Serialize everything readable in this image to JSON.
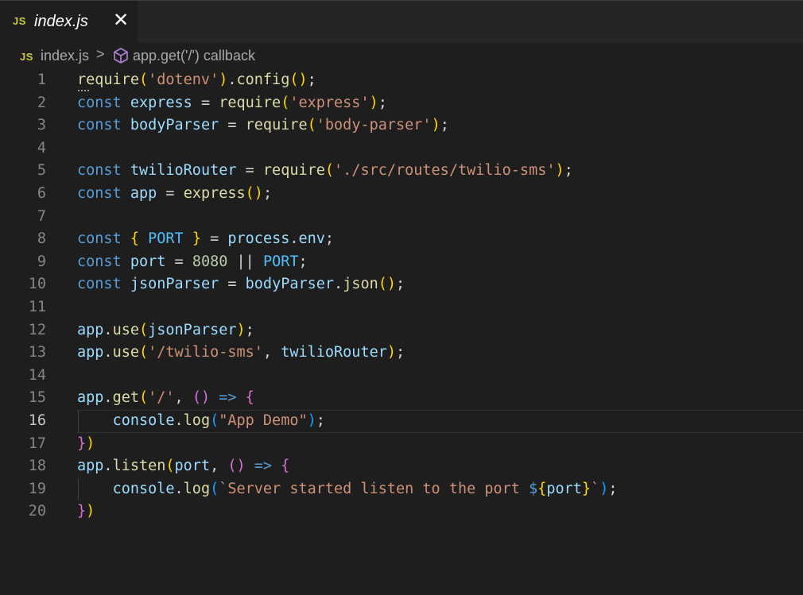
{
  "tab": {
    "icon_text": "JS",
    "title": "index.js"
  },
  "breadcrumb": {
    "icon_text": "JS",
    "file": "index.js",
    "separator": ">",
    "symbol": "app.get('/') callback"
  },
  "active_line": 16,
  "lines": [
    {
      "n": 1,
      "tokens": [
        [
          "fn",
          "require"
        ],
        [
          "p1",
          "("
        ],
        [
          "str",
          "'dotenv'"
        ],
        [
          "p1",
          ")"
        ],
        [
          "pl",
          "."
        ],
        [
          "fn",
          "config"
        ],
        [
          "p1",
          "()"
        ],
        [
          "pl",
          ";"
        ]
      ]
    },
    {
      "n": 2,
      "tokens": [
        [
          "kw",
          "const"
        ],
        [
          "pl",
          " "
        ],
        [
          "var",
          "express"
        ],
        [
          "pl",
          " = "
        ],
        [
          "fn",
          "require"
        ],
        [
          "p1",
          "("
        ],
        [
          "str",
          "'express'"
        ],
        [
          "p1",
          ")"
        ],
        [
          "pl",
          ";"
        ]
      ]
    },
    {
      "n": 3,
      "tokens": [
        [
          "kw",
          "const"
        ],
        [
          "pl",
          " "
        ],
        [
          "var",
          "bodyParser"
        ],
        [
          "pl",
          " = "
        ],
        [
          "fn",
          "require"
        ],
        [
          "p1",
          "("
        ],
        [
          "str",
          "'body-parser'"
        ],
        [
          "p1",
          ")"
        ],
        [
          "pl",
          ";"
        ]
      ]
    },
    {
      "n": 4,
      "tokens": []
    },
    {
      "n": 5,
      "tokens": [
        [
          "kw",
          "const"
        ],
        [
          "pl",
          " "
        ],
        [
          "var",
          "twilioRouter"
        ],
        [
          "pl",
          " = "
        ],
        [
          "fn",
          "require"
        ],
        [
          "p1",
          "("
        ],
        [
          "str",
          "'./src/routes/twilio-sms'"
        ],
        [
          "p1",
          ")"
        ],
        [
          "pl",
          ";"
        ]
      ]
    },
    {
      "n": 6,
      "tokens": [
        [
          "kw",
          "const"
        ],
        [
          "pl",
          " "
        ],
        [
          "var",
          "app"
        ],
        [
          "pl",
          " = "
        ],
        [
          "fn",
          "express"
        ],
        [
          "p1",
          "()"
        ],
        [
          "pl",
          ";"
        ]
      ]
    },
    {
      "n": 7,
      "tokens": []
    },
    {
      "n": 8,
      "tokens": [
        [
          "kw",
          "const"
        ],
        [
          "pl",
          " "
        ],
        [
          "p1",
          "{"
        ],
        [
          "pl",
          " "
        ],
        [
          "con",
          "PORT"
        ],
        [
          "pl",
          " "
        ],
        [
          "p1",
          "}"
        ],
        [
          "pl",
          " = "
        ],
        [
          "var",
          "process"
        ],
        [
          "pl",
          "."
        ],
        [
          "var",
          "env"
        ],
        [
          "pl",
          ";"
        ]
      ]
    },
    {
      "n": 9,
      "tokens": [
        [
          "kw",
          "const"
        ],
        [
          "pl",
          " "
        ],
        [
          "var",
          "port"
        ],
        [
          "pl",
          " = "
        ],
        [
          "num",
          "8080"
        ],
        [
          "pl",
          " || "
        ],
        [
          "con",
          "PORT"
        ],
        [
          "pl",
          ";"
        ]
      ]
    },
    {
      "n": 10,
      "tokens": [
        [
          "kw",
          "const"
        ],
        [
          "pl",
          " "
        ],
        [
          "var",
          "jsonParser"
        ],
        [
          "pl",
          " = "
        ],
        [
          "var",
          "bodyParser"
        ],
        [
          "pl",
          "."
        ],
        [
          "fn",
          "json"
        ],
        [
          "p1",
          "()"
        ],
        [
          "pl",
          ";"
        ]
      ]
    },
    {
      "n": 11,
      "tokens": []
    },
    {
      "n": 12,
      "tokens": [
        [
          "var",
          "app"
        ],
        [
          "pl",
          "."
        ],
        [
          "fn",
          "use"
        ],
        [
          "p1",
          "("
        ],
        [
          "var",
          "jsonParser"
        ],
        [
          "p1",
          ")"
        ],
        [
          "pl",
          ";"
        ]
      ]
    },
    {
      "n": 13,
      "tokens": [
        [
          "var",
          "app"
        ],
        [
          "pl",
          "."
        ],
        [
          "fn",
          "use"
        ],
        [
          "p1",
          "("
        ],
        [
          "str",
          "'/twilio-sms'"
        ],
        [
          "pl",
          ", "
        ],
        [
          "var",
          "twilioRouter"
        ],
        [
          "p1",
          ")"
        ],
        [
          "pl",
          ";"
        ]
      ]
    },
    {
      "n": 14,
      "tokens": []
    },
    {
      "n": 15,
      "tokens": [
        [
          "var",
          "app"
        ],
        [
          "pl",
          "."
        ],
        [
          "fn",
          "get"
        ],
        [
          "p1",
          "("
        ],
        [
          "str",
          "'/'"
        ],
        [
          "pl",
          ", "
        ],
        [
          "p2",
          "()"
        ],
        [
          "pl",
          " "
        ],
        [
          "kw",
          "=>"
        ],
        [
          "pl",
          " "
        ],
        [
          "p2",
          "{"
        ]
      ]
    },
    {
      "n": 16,
      "tokens": [
        [
          "pl",
          "    "
        ],
        [
          "var",
          "console"
        ],
        [
          "pl",
          "."
        ],
        [
          "fn",
          "log"
        ],
        [
          "p3",
          "("
        ],
        [
          "str",
          "\"App Demo\""
        ],
        [
          "p3",
          ")"
        ],
        [
          "pl",
          ";"
        ]
      ]
    },
    {
      "n": 17,
      "tokens": [
        [
          "p2",
          "}"
        ],
        [
          "p1",
          ")"
        ]
      ]
    },
    {
      "n": 18,
      "tokens": [
        [
          "var",
          "app"
        ],
        [
          "pl",
          "."
        ],
        [
          "fn",
          "listen"
        ],
        [
          "p1",
          "("
        ],
        [
          "var",
          "port"
        ],
        [
          "pl",
          ", "
        ],
        [
          "p2",
          "()"
        ],
        [
          "pl",
          " "
        ],
        [
          "kw",
          "=>"
        ],
        [
          "pl",
          " "
        ],
        [
          "p2",
          "{"
        ]
      ]
    },
    {
      "n": 19,
      "tokens": [
        [
          "pl",
          "    "
        ],
        [
          "var",
          "console"
        ],
        [
          "pl",
          "."
        ],
        [
          "fn",
          "log"
        ],
        [
          "p3",
          "("
        ],
        [
          "str",
          "`Server started listen to the port "
        ],
        [
          "kw",
          "$"
        ],
        [
          "p1",
          "{"
        ],
        [
          "var",
          "port"
        ],
        [
          "p1",
          "}"
        ],
        [
          "str",
          "`"
        ],
        [
          "p3",
          ")"
        ],
        [
          "pl",
          ";"
        ]
      ]
    },
    {
      "n": 20,
      "tokens": [
        [
          "p2",
          "}"
        ],
        [
          "p1",
          ")"
        ]
      ]
    }
  ]
}
